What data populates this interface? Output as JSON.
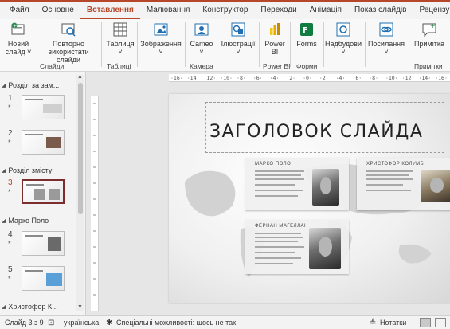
{
  "tabs": [
    "Файл",
    "Основне",
    "Вставлення",
    "Малювання",
    "Конструктор",
    "Переходи",
    "Анімація",
    "Показ слайдів",
    "Рецензування"
  ],
  "active_tab": "Вставлення",
  "ribbon": {
    "new_slide": "Новий\nслайд ˅",
    "reuse_slides": "Повторно\nвикористати слайди",
    "group_slides": "Слайди",
    "table": "Таблиця\n˅",
    "group_tables": "Таблиці",
    "images": "Зображення\n˅",
    "cameo": "Cameo\n˅",
    "group_camera": "Камера",
    "illustrations": "Ілюстрації\n˅",
    "power_bi": "Power\nBI",
    "group_power_bi": "Power BI",
    "forms": "Forms",
    "group_forms": "Форми",
    "addins": "Надбудови\n˅",
    "links": "Посилання\n˅",
    "comment": "Примітка",
    "group_comments": "Примітки"
  },
  "thumbnails": {
    "sections": [
      {
        "label": "Розділ за зам..."
      },
      {
        "label": "Розділ змісту"
      },
      {
        "label": "Марко Поло"
      },
      {
        "label": "Христофор К..."
      }
    ],
    "slides": [
      {
        "num": "1",
        "star": "*"
      },
      {
        "num": "2",
        "star": "*"
      },
      {
        "num": "3",
        "star": "*"
      },
      {
        "num": "4",
        "star": "*"
      },
      {
        "num": "5",
        "star": "*"
      }
    ]
  },
  "ruler": {
    "ticks": [
      "·16·",
      "·14·",
      "·12·",
      "·10·",
      "·8·",
      "·6·",
      "·4·",
      "·2·",
      "·0·",
      "·2·",
      "·4·",
      "·6·",
      "·8·",
      "·10·",
      "·12·",
      "·14·",
      "·16·"
    ]
  },
  "slide": {
    "title": "ЗАГОЛОВОК СЛАЙДА",
    "cards": [
      "МАРКО ПОЛО",
      "ХРИСТОФОР КОЛУМБ",
      "ФЕРНАН МАГЕЛЛАН"
    ]
  },
  "status": {
    "slide_counter": "Слайд 3 з 9",
    "language": "українська",
    "accessibility": "Спеціальні можливості: щось не так",
    "notes": "Нотатки"
  },
  "colors": {
    "accent": "#b7472a",
    "selected_thumb_border": "#7a2e2e"
  }
}
